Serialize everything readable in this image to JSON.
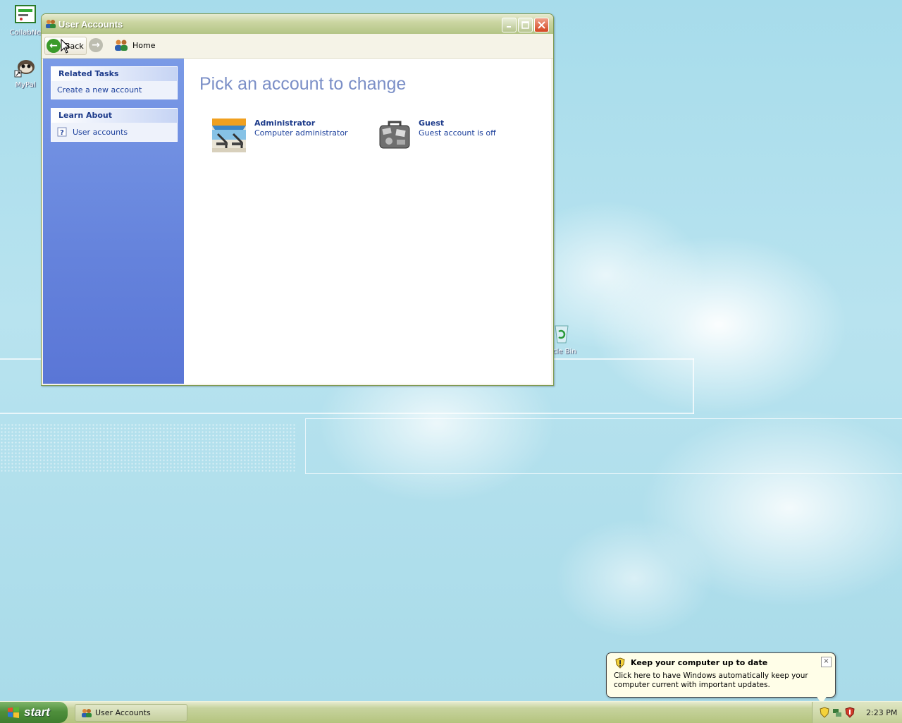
{
  "desktop": {
    "icons": [
      {
        "label": "CollabNe",
        "icon": "collabnet-icon"
      },
      {
        "label": "MyPal",
        "icon": "mypal-icon"
      },
      {
        "label": "cle Bin",
        "icon": "recycle-bin-icon"
      }
    ]
  },
  "window": {
    "title": "User Accounts",
    "toolbar": {
      "back_label": "Back",
      "home_label": "Home"
    },
    "sidebar": {
      "related_tasks": {
        "header": "Related Tasks",
        "items": [
          "Create a new account"
        ]
      },
      "learn_about": {
        "header": "Learn About",
        "items": [
          "User accounts"
        ]
      }
    },
    "main": {
      "heading": "Pick an account to change",
      "accounts": [
        {
          "name": "Administrator",
          "description": "Computer administrator",
          "icon": "beach-chair-icon"
        },
        {
          "name": "Guest",
          "description": "Guest account is off",
          "icon": "suitcase-icon"
        }
      ]
    }
  },
  "balloon": {
    "title": "Keep your computer up to date",
    "text": "Click here to have Windows automatically keep your computer current with important updates."
  },
  "taskbar": {
    "start_label": "start",
    "tasks": [
      "User Accounts"
    ],
    "clock": "2:23 PM"
  },
  "colors": {
    "title_bar": "#b3c486",
    "sidebar": "#6583dc",
    "heading": "#7b8fc7",
    "link": "#1b3f9b"
  }
}
